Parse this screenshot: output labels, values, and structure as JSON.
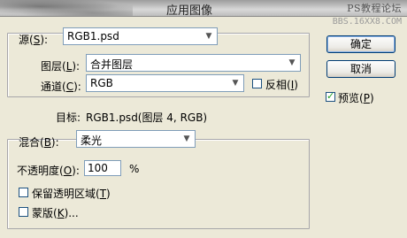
{
  "window": {
    "title": "应用图像",
    "watermark": "PS教程论坛",
    "watermark_url": "BBS.16XX8.COM"
  },
  "source_group": {
    "source_label": "源(",
    "source_key": "S",
    "source_label_end": "):",
    "source_value": "RGB1.psd",
    "layer_label": "图层(",
    "layer_key": "L",
    "layer_label_end": "):",
    "layer_value": "合并图层",
    "channel_label": "通道(",
    "channel_key": "C",
    "channel_label_end": "):",
    "channel_value": "RGB",
    "invert_label": "反相(",
    "invert_key": "I",
    "invert_label_end": ")",
    "invert_checked": false
  },
  "target": {
    "label": "目标:",
    "value": "RGB1.psd(图层 4, RGB)"
  },
  "blend_group": {
    "blend_label": "混合(",
    "blend_key": "B",
    "blend_label_end": "):",
    "blend_value": "柔光",
    "opacity_label": "不透明度(",
    "opacity_key": "O",
    "opacity_label_end": "):",
    "opacity_value": "100",
    "opacity_unit": "%",
    "preserve_label": "保留透明区域(",
    "preserve_key": "T",
    "preserve_label_end": ")",
    "preserve_checked": false,
    "mask_label": "蒙版(",
    "mask_key": "K",
    "mask_label_end": ")...",
    "mask_checked": false
  },
  "buttons": {
    "ok": "确定",
    "cancel": "取消"
  },
  "preview": {
    "label": "预览(",
    "key": "P",
    "label_end": ")",
    "checked": true
  },
  "colors": {
    "dialog_bg": "#ece9d8",
    "field_border": "#7f9db9",
    "button_border": "#003c74"
  }
}
